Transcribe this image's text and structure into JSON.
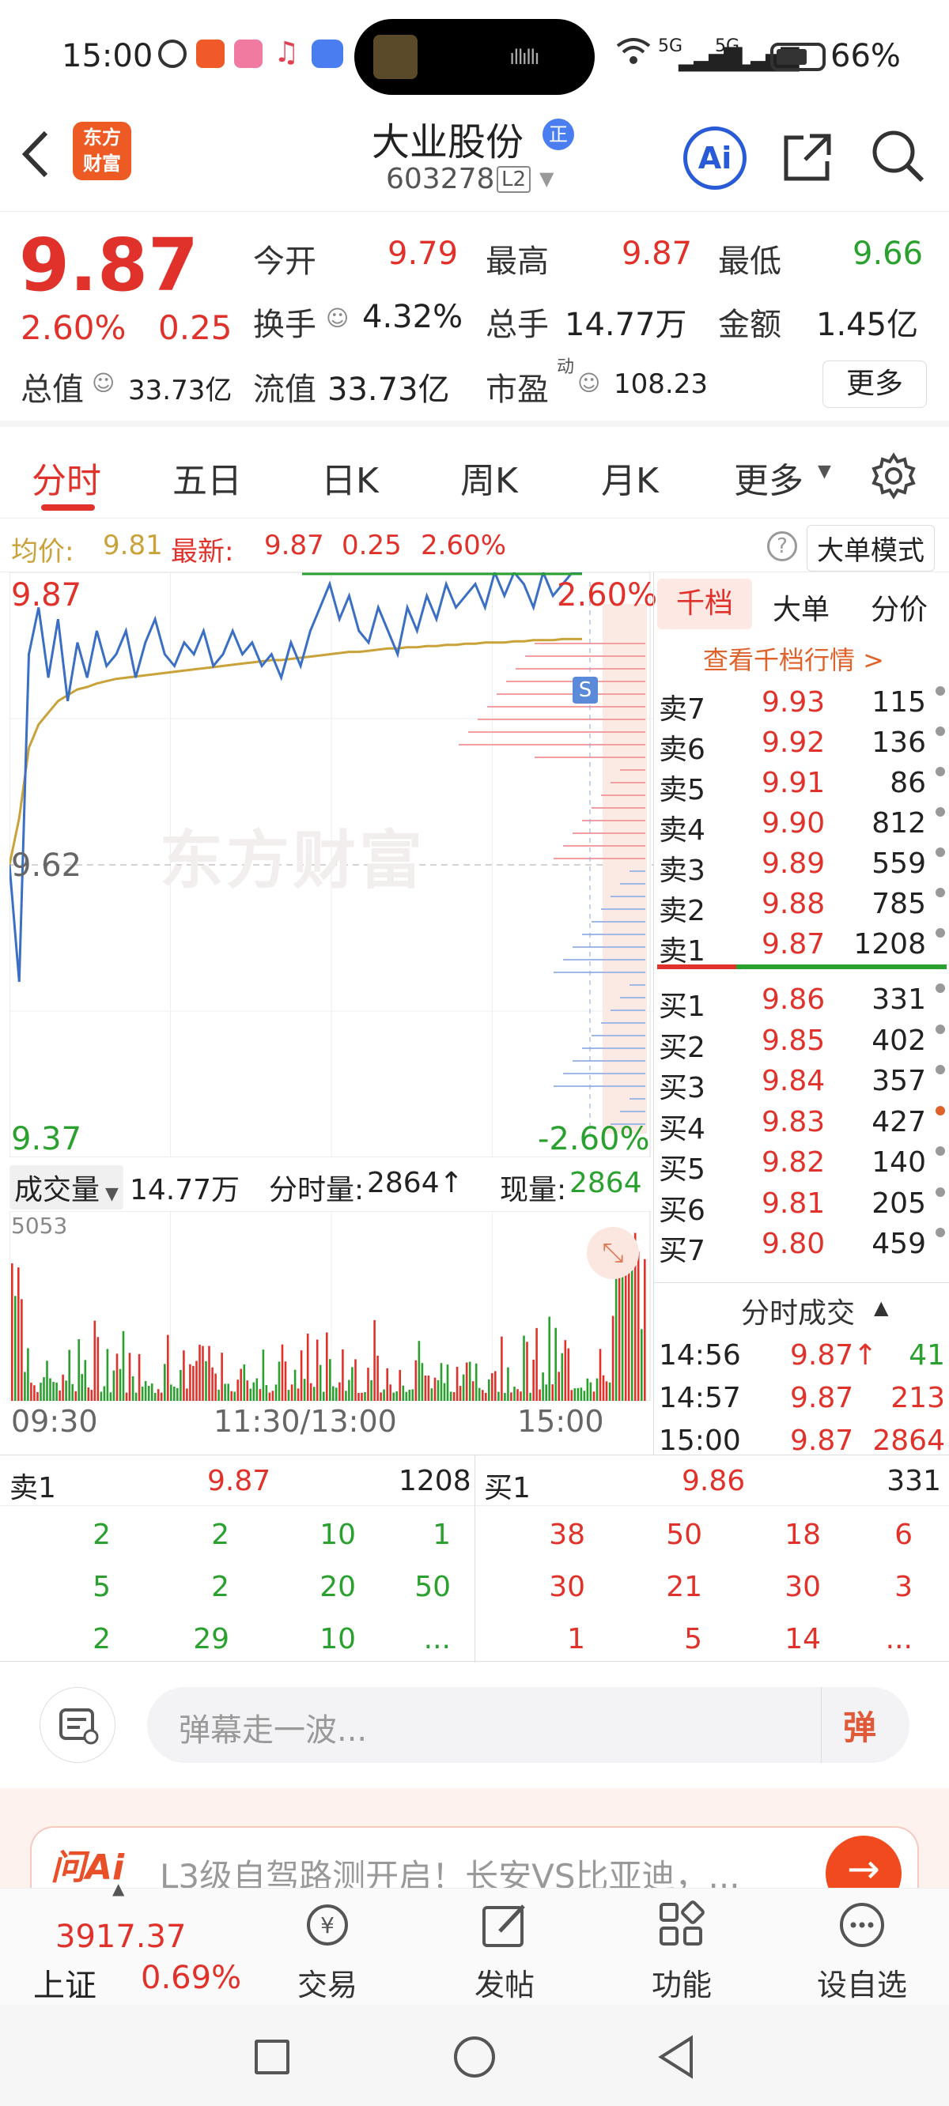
{
  "status_bar": {
    "time": "15:00",
    "battery": "66%",
    "signal1": "5G",
    "signal2": "5G"
  },
  "header": {
    "logo_line1": "东方",
    "logo_line2": "财富",
    "title": "大业股份",
    "badge": "正",
    "code": "603278",
    "level": "L2"
  },
  "quote": {
    "price": "9.87",
    "pct": "2.60%",
    "change": "0.25",
    "open_label": "今开",
    "open": "9.79",
    "high_label": "最高",
    "high": "9.87",
    "low_label": "最低",
    "low": "9.66",
    "turnover_label": "换手",
    "turnover": "4.32%",
    "volume_label": "总手",
    "volume": "14.77万",
    "amount_label": "金额",
    "amount": "1.45亿",
    "mcap_label": "总值",
    "mcap": "33.73亿",
    "float_label": "流值",
    "float": "33.73亿",
    "pe_label": "市盈",
    "pe_sup": "动",
    "pe": "108.23",
    "more": "更多"
  },
  "tabs": [
    "分时",
    "五日",
    "日K",
    "周K",
    "月K",
    "更多"
  ],
  "infoline": {
    "avg_label": "均价:",
    "avg": "9.81",
    "latest_label": "最新:",
    "latest": "9.87",
    "change": "0.25",
    "pct": "2.60%",
    "mode": "大单模式"
  },
  "chart": {
    "y_top": "9.87",
    "y_mid": "9.62",
    "y_bot": "9.37",
    "pct_top": "2.60%",
    "pct_bot": "-2.60%",
    "watermark": "东方财富",
    "s_marker": "S"
  },
  "chart_data": {
    "type": "line",
    "ylim": [
      9.37,
      9.87
    ],
    "series": [
      {
        "name": "price",
        "values": [
          9.62,
          9.52,
          9.8,
          9.84,
          9.78,
          9.83,
          9.76,
          9.81,
          9.78,
          9.82,
          9.79,
          9.8,
          9.82,
          9.78,
          9.81,
          9.83,
          9.8,
          9.79,
          9.81,
          9.8,
          9.82,
          9.79,
          9.8,
          9.82,
          9.8,
          9.81,
          9.79,
          9.8,
          9.78,
          9.81,
          9.79,
          9.82,
          9.84,
          9.86,
          9.83,
          9.85,
          9.82,
          9.81,
          9.84,
          9.82,
          9.8,
          9.84,
          9.82,
          9.85,
          9.83,
          9.86,
          9.84,
          9.85,
          9.86,
          9.84,
          9.87,
          9.85,
          9.87,
          9.86,
          9.84,
          9.87,
          9.85,
          9.86,
          9.87,
          9.87
        ]
      },
      {
        "name": "avg",
        "values": [
          9.62,
          9.66,
          9.72,
          9.74,
          9.75,
          9.76,
          9.765,
          9.77,
          9.772,
          9.775,
          9.777,
          9.779,
          9.78,
          9.781,
          9.782,
          9.783,
          9.784,
          9.785,
          9.786,
          9.787,
          9.788,
          9.789,
          9.79,
          9.791,
          9.792,
          9.793,
          9.794,
          9.795,
          9.795,
          9.796,
          9.797,
          9.798,
          9.799,
          9.8,
          9.801,
          9.802,
          9.802,
          9.803,
          9.804,
          9.805,
          9.805,
          9.806,
          9.806,
          9.807,
          9.807,
          9.808,
          9.808,
          9.809,
          9.809,
          9.81,
          9.81,
          9.81,
          9.811,
          9.811,
          9.812,
          9.812,
          9.812,
          9.813,
          9.813,
          9.813
        ]
      }
    ],
    "volume_max": "5053"
  },
  "orderbook": {
    "tabs": [
      "千档",
      "大单",
      "分价"
    ],
    "link": "查看千档行情 >",
    "asks": [
      {
        "label": "卖7",
        "price": "9.93",
        "vol": "115"
      },
      {
        "label": "卖6",
        "price": "9.92",
        "vol": "136"
      },
      {
        "label": "卖5",
        "price": "9.91",
        "vol": "86"
      },
      {
        "label": "卖4",
        "price": "9.90",
        "vol": "812"
      },
      {
        "label": "卖3",
        "price": "9.89",
        "vol": "559"
      },
      {
        "label": "卖2",
        "price": "9.88",
        "vol": "785"
      },
      {
        "label": "卖1",
        "price": "9.87",
        "vol": "1208"
      }
    ],
    "bids": [
      {
        "label": "买1",
        "price": "9.86",
        "vol": "331"
      },
      {
        "label": "买2",
        "price": "9.85",
        "vol": "402"
      },
      {
        "label": "买3",
        "price": "9.84",
        "vol": "357"
      },
      {
        "label": "买4",
        "price": "9.83",
        "vol": "427"
      },
      {
        "label": "买5",
        "price": "9.82",
        "vol": "140"
      },
      {
        "label": "买6",
        "price": "9.81",
        "vol": "205"
      },
      {
        "label": "买7",
        "price": "9.80",
        "vol": "459"
      }
    ],
    "ticks_title": "分时成交",
    "ticks": [
      {
        "time": "14:56",
        "price": "9.87↑",
        "vol": "41"
      },
      {
        "time": "14:57",
        "price": "9.87",
        "vol": "213"
      },
      {
        "time": "15:00",
        "price": "9.87",
        "vol": "2864"
      }
    ]
  },
  "volume": {
    "label": "成交量",
    "total": "14.77万",
    "fs_label": "分时量:",
    "fs": "2864↑",
    "now_label": "现量:",
    "now": "2864",
    "max": "5053"
  },
  "time_axis": [
    "09:30",
    "11:30/13:00",
    "15:00"
  ],
  "level1": {
    "ask_label": "卖1",
    "ask_price": "9.87",
    "ask_vol": "1208",
    "bid_label": "买1",
    "bid_price": "9.86",
    "bid_vol": "331",
    "ask_rows": [
      [
        "2",
        "2",
        "10",
        "1"
      ],
      [
        "5",
        "2",
        "20",
        "50"
      ],
      [
        "2",
        "29",
        "10",
        "..."
      ]
    ],
    "bid_rows": [
      [
        "38",
        "50",
        "18",
        "6"
      ],
      [
        "30",
        "21",
        "30",
        "3"
      ],
      [
        "1",
        "5",
        "14",
        "..."
      ]
    ]
  },
  "comment": {
    "placeholder": "弹幕走一波...",
    "danmu": "弹"
  },
  "ai_banner": {
    "logo": "问Ai",
    "text": "L3级自驾路测开启！长安VS比亚迪，..."
  },
  "bottom_nav": {
    "index_value": "3917.37",
    "index_name": "上证",
    "index_pct": "0.69%",
    "items": [
      "交易",
      "发帖",
      "功能",
      "设自选"
    ]
  },
  "colors": {
    "up": "#e0322b",
    "down": "#2aa12f",
    "price_line": "#3b6fc4",
    "avg_line": "#c9a23a",
    "accent": "#ee5a24"
  }
}
